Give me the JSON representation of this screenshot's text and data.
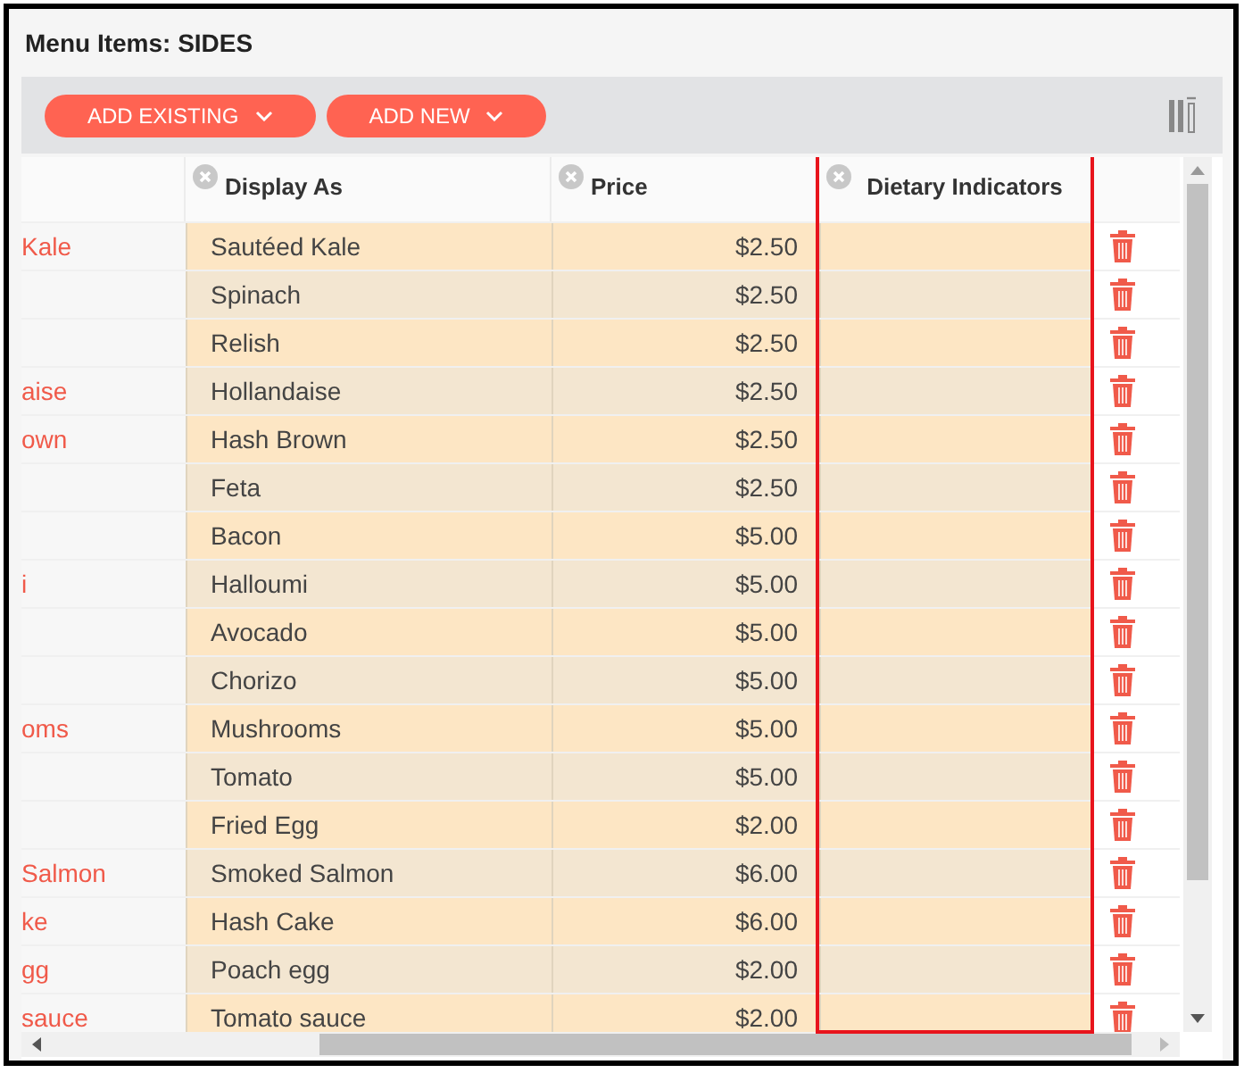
{
  "title": "Menu Items: SIDES",
  "toolbar": {
    "buttons": [
      {
        "label": "ADD EXISTING"
      },
      {
        "label": "ADD NEW"
      }
    ]
  },
  "table": {
    "columns": [
      {
        "removable": false,
        "highlighted": false
      },
      {
        "label": "Display As",
        "removable": true,
        "highlighted": false
      },
      {
        "label": "Price",
        "removable": true,
        "highlighted": false
      },
      {
        "label": "Dietary Indicators",
        "removable": true,
        "highlighted": true
      }
    ],
    "rows": [
      {
        "column_1": "Kale",
        "display_as": "Sautéed Kale",
        "price": "$2.50"
      },
      {
        "column_1": "",
        "display_as": "Spinach",
        "price": "$2.50"
      },
      {
        "column_1": "",
        "display_as": "Relish",
        "price": "$2.50"
      },
      {
        "column_1": "aise",
        "display_as": "Hollandaise",
        "price": "$2.50"
      },
      {
        "column_1": "own",
        "display_as": "Hash Brown",
        "price": "$2.50"
      },
      {
        "column_1": "",
        "display_as": "Feta",
        "price": "$2.50"
      },
      {
        "column_1": "",
        "display_as": "Bacon",
        "price": "$5.00"
      },
      {
        "column_1": "i",
        "display_as": "Halloumi",
        "price": "$5.00"
      },
      {
        "column_1": "",
        "display_as": "Avocado",
        "price": "$5.00"
      },
      {
        "column_1": "",
        "display_as": "Chorizo",
        "price": "$5.00"
      },
      {
        "column_1": "oms",
        "display_as": "Mushrooms",
        "price": "$5.00"
      },
      {
        "column_1": "",
        "display_as": "Tomato",
        "price": "$5.00"
      },
      {
        "column_1": "",
        "display_as": "Fried Egg",
        "price": "$2.00"
      },
      {
        "column_1": "Salmon",
        "display_as": "Smoked Salmon",
        "price": "$6.00"
      },
      {
        "column_1": "ke",
        "display_as": "Hash Cake",
        "price": "$6.00"
      },
      {
        "column_1": "gg",
        "display_as": "Poach egg",
        "price": "$2.00"
      },
      {
        "column_1": "sauce",
        "display_as": "Tomato sauce",
        "price": "$2.00"
      }
    ]
  }
}
